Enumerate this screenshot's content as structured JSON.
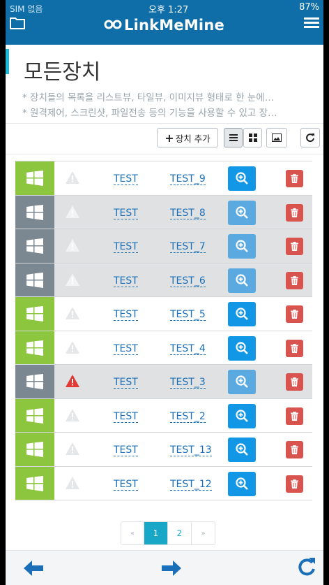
{
  "status_bar": {
    "carrier": "SIM 없음",
    "time": "오후 1:27",
    "battery": "87%"
  },
  "app": {
    "brand": "LinkMeMine"
  },
  "page": {
    "title": "모든장치",
    "desc_line1": "* 장치들의 목록을 리스트뷰, 타일뷰, 이미지뷰 형태로 한 눈에…",
    "desc_line2": "* 원격제어, 스크린샷, 파일전송 등의 기능을 사용할 수 있고 장…"
  },
  "toolbar": {
    "add_device_label": "장치 추가"
  },
  "devices": [
    {
      "status": "online",
      "alert": false,
      "group": "TEST",
      "name": "TEST_9"
    },
    {
      "status": "offline",
      "alert": false,
      "group": "TEST",
      "name": "TEST_8"
    },
    {
      "status": "offline",
      "alert": false,
      "group": "TEST",
      "name": "TEST_7"
    },
    {
      "status": "offline",
      "alert": false,
      "group": "TEST",
      "name": "TEST_6"
    },
    {
      "status": "online",
      "alert": false,
      "group": "TEST",
      "name": "TEST_5"
    },
    {
      "status": "online",
      "alert": false,
      "group": "TEST",
      "name": "TEST_4"
    },
    {
      "status": "offline",
      "alert": true,
      "group": "TEST",
      "name": "TEST_3"
    },
    {
      "status": "online",
      "alert": false,
      "group": "TEST",
      "name": "TEST_2"
    },
    {
      "status": "online",
      "alert": false,
      "group": "TEST",
      "name": "TEST_13"
    },
    {
      "status": "online",
      "alert": false,
      "group": "TEST",
      "name": "TEST_12"
    }
  ],
  "pagination": {
    "prev": "«",
    "pages": [
      "1",
      "2"
    ],
    "next": "»",
    "current": "1"
  },
  "colors": {
    "header_bg": "#0f6ea8",
    "online": "#8cc63f",
    "offline": "#7b8791",
    "zoom": "#1296e6",
    "delete": "#d9534f",
    "alert": "#e53935",
    "accent": "#19b9d7"
  },
  "icons": {
    "folder": "folder-icon",
    "menu": "menu-icon",
    "os": "windows-icon",
    "alert": "warning-icon",
    "zoom": "zoom-in-icon",
    "delete": "trash-icon",
    "list_view": "list-view-icon",
    "tile_view": "tile-view-icon",
    "image_view": "image-view-icon",
    "refresh": "refresh-icon",
    "back": "arrow-left-icon",
    "forward": "arrow-right-icon",
    "reload": "reload-icon"
  }
}
